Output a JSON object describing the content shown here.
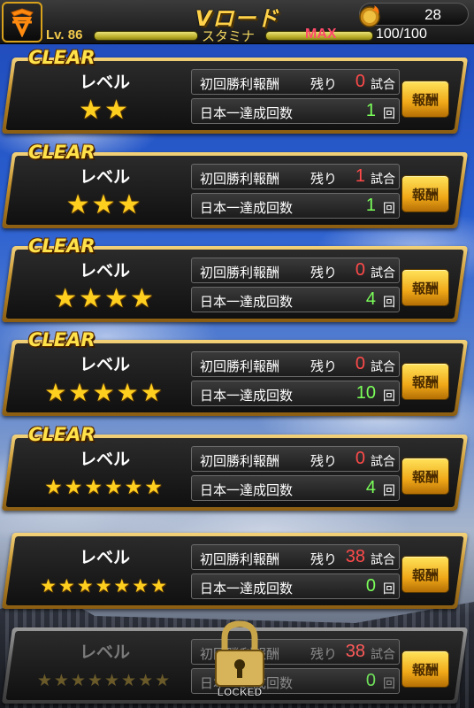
{
  "header": {
    "title": "Vロード",
    "coins": "28",
    "level": "Lv. 86",
    "stamina_label": "スタミナ",
    "stamina_max": "MAX",
    "stamina_value": "100/100"
  },
  "common": {
    "clear": "CLEAR",
    "level_label": "レベル",
    "first_win_reward": "初回勝利報酬",
    "remaining": "残り",
    "games_unit": "試合",
    "championship_count": "日本一達成回数",
    "times_unit": "回",
    "reward_button": "報酬",
    "locked": "LOCKED"
  },
  "rows": [
    {
      "stars": 2,
      "cleared": true,
      "remaining_games": "0",
      "championships": "1",
      "star_size": 30
    },
    {
      "stars": 3,
      "cleared": true,
      "remaining_games": "1",
      "championships": "1",
      "star_size": 30
    },
    {
      "stars": 4,
      "cleared": true,
      "remaining_games": "0",
      "championships": "4",
      "star_size": 30
    },
    {
      "stars": 5,
      "cleared": true,
      "remaining_games": "0",
      "championships": "10",
      "star_size": 28
    },
    {
      "stars": 6,
      "cleared": true,
      "remaining_games": "0",
      "championships": "4",
      "star_size": 23
    },
    {
      "stars": 7,
      "cleared": false,
      "remaining_games": "38",
      "championships": "0",
      "star_size": 21
    },
    {
      "stars": 8,
      "cleared": false,
      "locked": true,
      "remaining_games": "38",
      "championships": "0",
      "star_size": 19
    }
  ],
  "colors": {
    "gold": "#ffd24a",
    "red_count": "#ff4a4a",
    "green_count": "#7bff5a",
    "max_pink": "#ff4a6a"
  },
  "icons": {
    "logo": "giants-logo-icon",
    "coin": "fire-coin-icon",
    "star": "star-icon",
    "lock": "padlock-icon"
  }
}
